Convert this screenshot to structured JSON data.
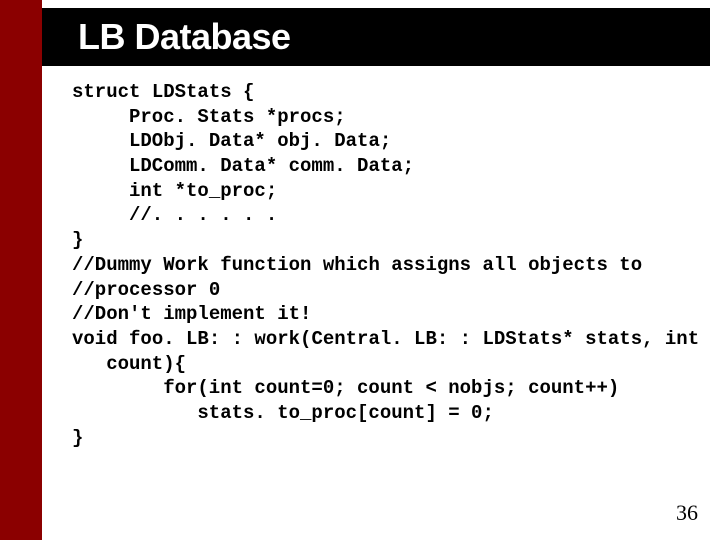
{
  "title": "LB Database",
  "code": {
    "l1": "struct LDStats {",
    "l2": "Proc. Stats *procs;",
    "l3": "LDObj. Data* obj. Data;",
    "l4": "LDComm. Data* comm. Data;",
    "l5": "int *to_proc;",
    "l6": "//. . . . . .",
    "l7": "}",
    "l8": "//Dummy Work function which assigns all objects to",
    "l9": "//processor 0",
    "l10": "//Don't implement it!",
    "l11": "void foo. LB: : work(Central. LB: : LDStats* stats, int",
    "l12": "count){",
    "l13": "for(int count=0; count < nobjs; count++)",
    "l14": "stats. to_proc[count] = 0;",
    "l15": "}"
  },
  "page_number": "36"
}
